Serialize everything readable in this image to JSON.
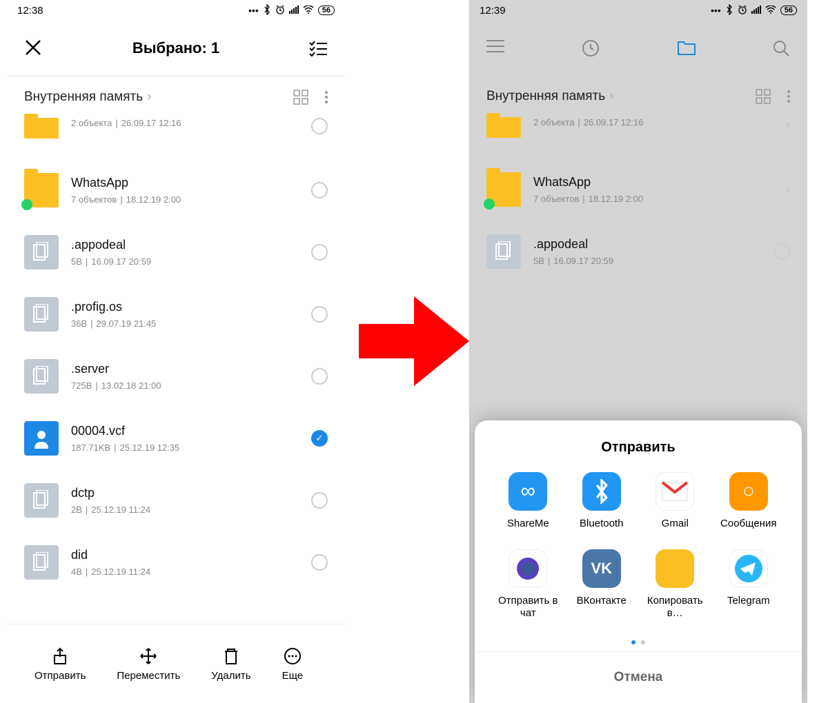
{
  "left": {
    "status": {
      "time": "12:38",
      "battery": "56"
    },
    "header": {
      "title": "Выбрано: 1"
    },
    "breadcrumb": "Внутренняя память",
    "files": [
      {
        "name": "",
        "meta1": "2 объекта",
        "meta2": "26.09.17 12:16",
        "icon": "folder",
        "checked": false,
        "cut": true
      },
      {
        "name": "WhatsApp",
        "meta1": "7 объектов",
        "meta2": "18.12.19 2:00",
        "icon": "folder-wa",
        "checked": false
      },
      {
        "name": ".appodeal",
        "meta1": "5B",
        "meta2": "16.09.17 20:59",
        "icon": "doc",
        "checked": false
      },
      {
        "name": ".profig.os",
        "meta1": "36B",
        "meta2": "29.07.19 21:45",
        "icon": "doc",
        "checked": false
      },
      {
        "name": ".server",
        "meta1": "725B",
        "meta2": "13.02.18 21:00",
        "icon": "doc",
        "checked": false
      },
      {
        "name": "00004.vcf",
        "meta1": "187.71KB",
        "meta2": "25.12.19 12:35",
        "icon": "person",
        "checked": true
      },
      {
        "name": "dctp",
        "meta1": "2B",
        "meta2": "25.12.19 11:24",
        "icon": "doc",
        "checked": false
      },
      {
        "name": "did",
        "meta1": "4B",
        "meta2": "25.12.19 11:24",
        "icon": "doc",
        "checked": false
      }
    ],
    "actions": {
      "send": "Отправить",
      "move": "Переместить",
      "delete": "Удалить",
      "more": "Еще"
    }
  },
  "right": {
    "status": {
      "time": "12:39",
      "battery": "56"
    },
    "breadcrumb": "Внутренняя память",
    "files": [
      {
        "name": "",
        "meta1": "2 объекта",
        "meta2": "26.09.17 12:16",
        "icon": "folder",
        "cut": true
      },
      {
        "name": "WhatsApp",
        "meta1": "7 объектов",
        "meta2": "18.12.19 2:00",
        "icon": "folder-wa"
      },
      {
        "name": ".appodeal",
        "meta1": "5B",
        "meta2": "16.09.17 20:59",
        "icon": "doc"
      }
    ],
    "share": {
      "title": "Отправить",
      "apps": [
        {
          "label": "ShareMe",
          "color": "#2196f3",
          "glyph": "∞"
        },
        {
          "label": "Bluetooth",
          "color": "#2196f3",
          "glyph": "bt"
        },
        {
          "label": "Gmail",
          "color": "#ffffff",
          "glyph": "gmail"
        },
        {
          "label": "Сообщения",
          "color": "#ff9800",
          "glyph": "○"
        },
        {
          "label": "Отправить в чат",
          "color": "#ffffff",
          "glyph": "chat"
        },
        {
          "label": "ВКонтакте",
          "color": "#4a76a8",
          "glyph": "VK"
        },
        {
          "label": "Копировать в…",
          "color": "#fbbf24",
          "glyph": ""
        },
        {
          "label": "Telegram",
          "color": "#ffffff",
          "glyph": "tg"
        }
      ],
      "cancel": "Отмена"
    }
  }
}
